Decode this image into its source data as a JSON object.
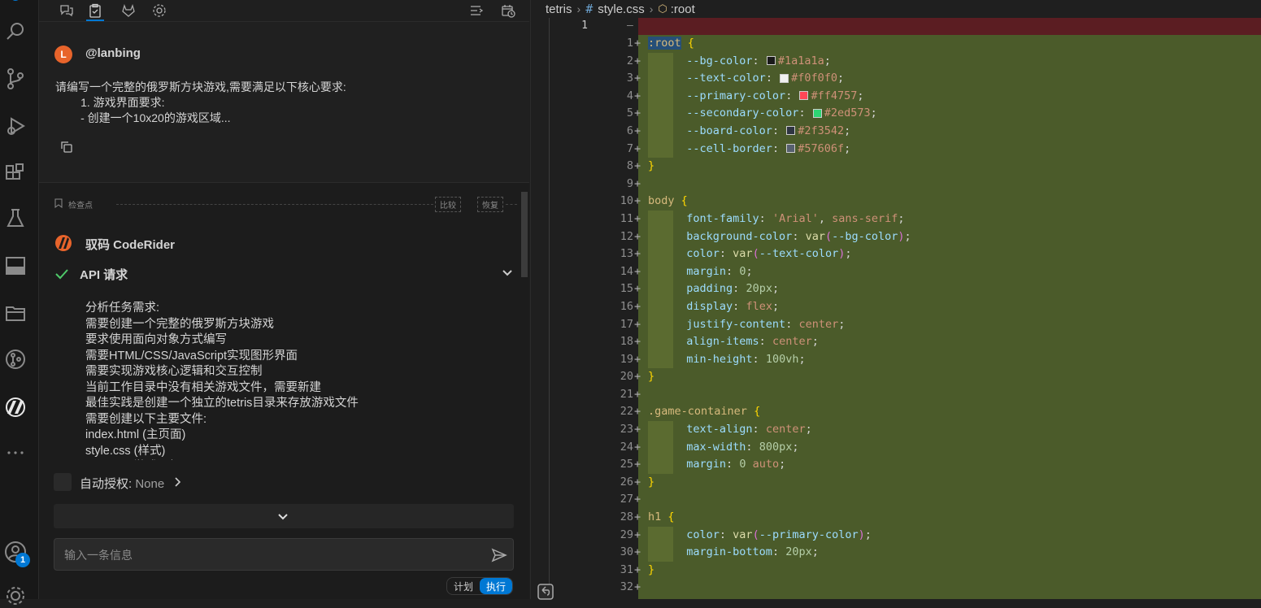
{
  "activity_bar": {
    "badge_count": "1"
  },
  "panel": {
    "tabs": [
      "chat-icon",
      "task-icon",
      "gitlab-icon",
      "gear-icon"
    ],
    "user": {
      "avatar_letter": "L",
      "name": "@lanbing",
      "message": "请编写一个完整的俄罗斯方块游戏,需要满足以下核心要求:\n        1. 游戏界面要求:\n        - 创建一个10x20的游戏区域..."
    },
    "checkpoint": {
      "label": "检查点",
      "compare": "比较",
      "restore": "恢复"
    },
    "assistant": {
      "name": "驭码 CodeRider",
      "api_label": "API 请求",
      "analysis": "分析任务需求:\n需要创建一个完整的俄罗斯方块游戏\n要求使用面向对象方式编写\n需要HTML/CSS/JavaScript实现图形界面\n需要实现游戏核心逻辑和交互控制\n当前工作目录中没有相关游戏文件，需要新建\n最佳实践是创建一个独立的tetris目录来存放游戏文件\n需要创建以下主要文件:\nindex.html (主页面)\nstyle.css (样式)\ngame.js (游戏逻辑)"
    },
    "auto_approve": {
      "label": "自动授权:",
      "value": "None"
    },
    "input": {
      "placeholder": "输入一条信息"
    },
    "mode": {
      "plan": "计划",
      "execute": "执行"
    }
  },
  "editor": {
    "breadcrumb": {
      "folder": "tetris",
      "file": "style.css",
      "symbol": ":root"
    },
    "left_line_number": "1",
    "colors": {
      "bg": "#1a1a1a",
      "text": "#f0f0f0",
      "primary": "#ff4757",
      "secondary": "#2ed573",
      "board": "#2f3542",
      "cell_border": "#57606f"
    },
    "lines": [
      {
        "n": "1"
      },
      {
        "n": "2"
      },
      {
        "n": "3"
      },
      {
        "n": "4"
      },
      {
        "n": "5"
      },
      {
        "n": "6"
      },
      {
        "n": "7"
      },
      {
        "n": "8"
      },
      {
        "n": "9"
      },
      {
        "n": "10"
      },
      {
        "n": "11"
      },
      {
        "n": "12"
      },
      {
        "n": "13"
      },
      {
        "n": "14"
      },
      {
        "n": "15"
      },
      {
        "n": "16"
      },
      {
        "n": "17"
      },
      {
        "n": "18"
      },
      {
        "n": "19"
      },
      {
        "n": "20"
      },
      {
        "n": "21"
      },
      {
        "n": "22"
      },
      {
        "n": "23"
      },
      {
        "n": "24"
      },
      {
        "n": "25"
      },
      {
        "n": "26"
      },
      {
        "n": "27"
      },
      {
        "n": "28"
      },
      {
        "n": "29"
      },
      {
        "n": "30"
      },
      {
        "n": "31"
      },
      {
        "n": "32"
      }
    ],
    "code": {
      "l1_sel": ":root",
      "l2_prop": "--bg-color",
      "l2_val": "#1a1a1a",
      "l3_prop": "--text-color",
      "l3_val": "#f0f0f0",
      "l4_prop": "--primary-color",
      "l4_val": "#ff4757",
      "l5_prop": "--secondary-color",
      "l5_val": "#2ed573",
      "l6_prop": "--board-color",
      "l6_val": "#2f3542",
      "l7_prop": "--cell-border",
      "l7_val": "#57606f",
      "l10_sel": "body",
      "l11_prop": "font-family",
      "l11_val1": "'Arial'",
      "l11_val2": "sans-serif",
      "l12_prop": "background-color",
      "l12_fn": "var",
      "l12_arg": "--bg-color",
      "l13_prop": "color",
      "l13_fn": "var",
      "l13_arg": "--text-color",
      "l14_prop": "margin",
      "l14_val": "0",
      "l15_prop": "padding",
      "l15_val": "20px",
      "l16_prop": "display",
      "l16_val": "flex",
      "l17_prop": "justify-content",
      "l17_val": "center",
      "l18_prop": "align-items",
      "l18_val": "center",
      "l19_prop": "min-height",
      "l19_val": "100vh",
      "l22_sel": ".game-container",
      "l23_prop": "text-align",
      "l23_val": "center",
      "l24_prop": "max-width",
      "l24_val": "800px",
      "l25_prop": "margin",
      "l25_val1": "0",
      "l25_val2": "auto",
      "l28_sel": "h1",
      "l29_prop": "color",
      "l29_fn": "var",
      "l29_arg": "--primary-color",
      "l30_prop": "margin-bottom",
      "l30_val": "20px"
    }
  }
}
